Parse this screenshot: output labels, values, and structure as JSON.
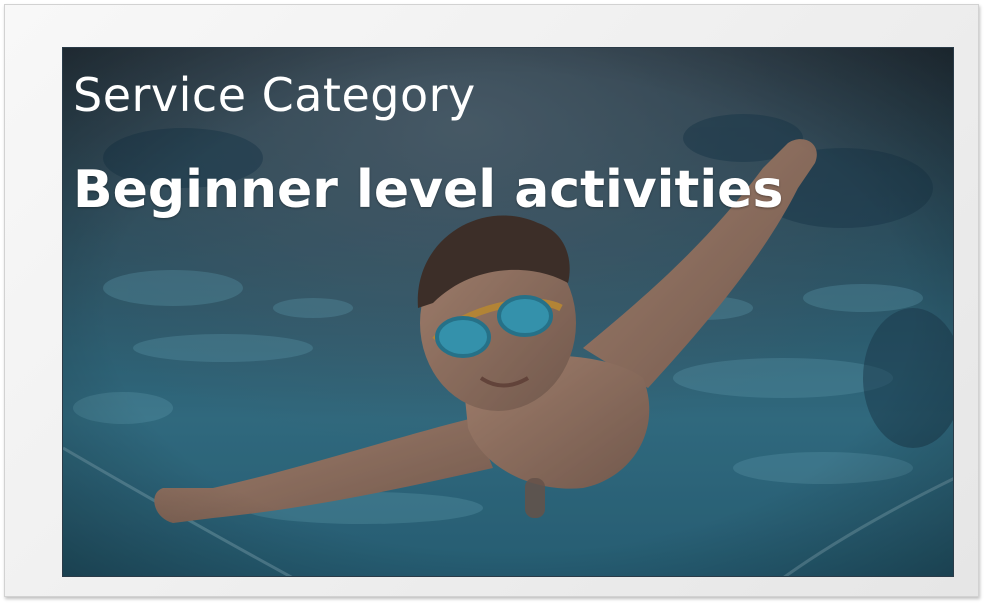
{
  "card": {
    "category_label": "Service Category",
    "title": "Beginner level activities"
  },
  "photo": {
    "subject": "child-swimming-underwater-with-goggles-icon",
    "palette": {
      "water_deep": "#1e4a63",
      "water_light": "#4fa6bf",
      "surface_dark": "#2c3640",
      "skin": "#b98a72",
      "goggles": "#3fb3d1",
      "goggle_strap": "#e0a23c"
    }
  }
}
